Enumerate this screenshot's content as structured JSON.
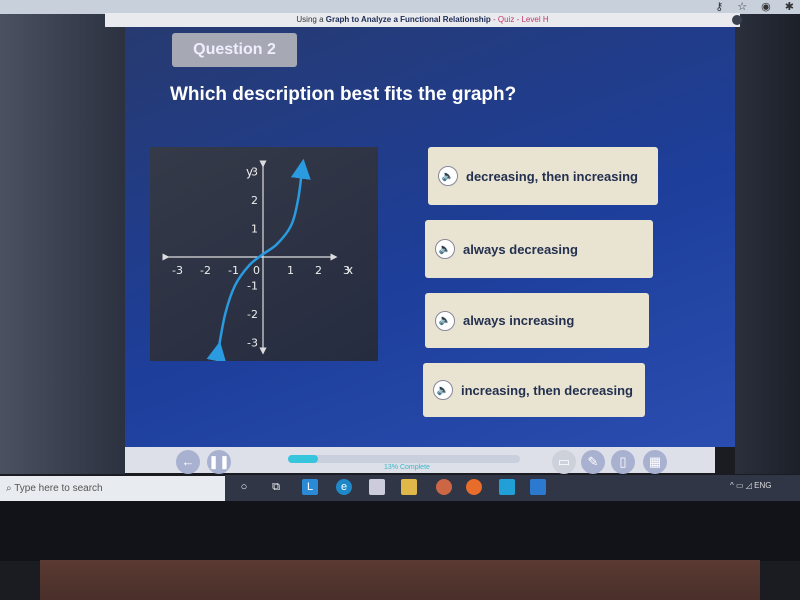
{
  "browser": {
    "icons": [
      "key-icon",
      "star-icon",
      "profile-icon",
      "extensions-icon"
    ]
  },
  "quiz": {
    "title_prefix": "Using a ",
    "title_main": "Graph to Analyze a Functional Relationship",
    "title_suffix": " - Quiz - Level H",
    "question_label": "Question 2",
    "prompt": "Which description best fits the graph?",
    "answers": [
      {
        "label": "decreasing, then increasing"
      },
      {
        "label": "always decreasing"
      },
      {
        "label": "always increasing"
      },
      {
        "label": "increasing, then decreasing"
      }
    ],
    "progress_percent": 13,
    "progress_text": "13% Complete"
  },
  "chart_data": {
    "type": "line",
    "xlabel": "x",
    "ylabel": "y",
    "xlim": [
      -3,
      3
    ],
    "ylim": [
      -3,
      3
    ],
    "x_ticks": [
      "-3",
      "-2",
      "-1",
      "0",
      "1",
      "2",
      "3"
    ],
    "y_ticks": [
      "3",
      "2",
      "1",
      "-1",
      "-2",
      "-3"
    ],
    "series": [
      {
        "color": "#2a9be0",
        "points": [
          [
            -1.6,
            -3.3
          ],
          [
            -1.35,
            -2
          ],
          [
            -1.0,
            -1.0
          ],
          [
            -0.5,
            -0.3
          ],
          [
            0,
            0.1
          ],
          [
            0.5,
            0.45
          ],
          [
            1.0,
            1.1
          ],
          [
            1.25,
            2
          ],
          [
            1.4,
            3.1
          ]
        ],
        "arrows": "both"
      }
    ]
  },
  "taskbar": {
    "search_placeholder": "Type here to search",
    "apps": [
      "cortana-icon",
      "task-view-icon",
      "launcher-l-icon",
      "edge-icon",
      "store-icon",
      "file-explorer-icon",
      "chrome-icon",
      "firefox-icon",
      "app-icon",
      "photos-icon"
    ],
    "tray_lang": "ENG"
  }
}
